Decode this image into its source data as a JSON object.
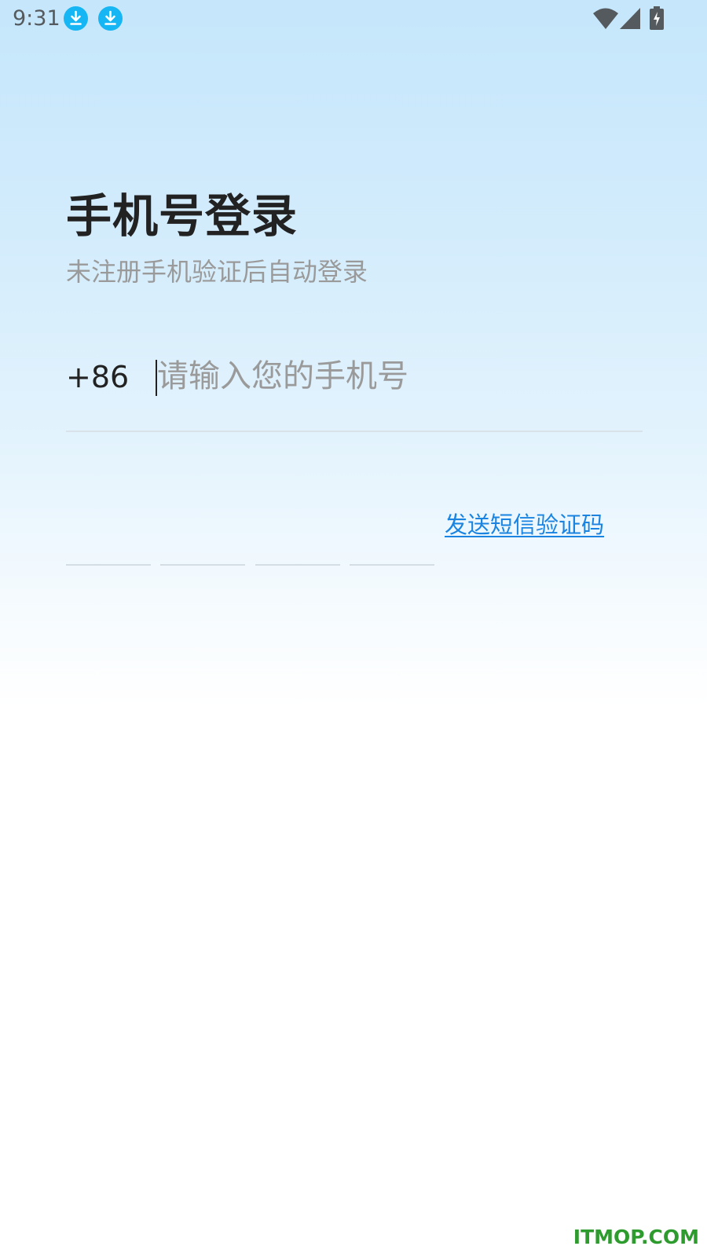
{
  "status_bar": {
    "time": "9:31",
    "icons": [
      "download-icon",
      "download-icon",
      "wifi-icon",
      "signal-icon",
      "battery-charging-icon"
    ]
  },
  "login": {
    "title": "手机号登录",
    "subtitle": "未注册手机验证后自动登录",
    "country_code": "+86",
    "phone_placeholder": "请输入您的手机号",
    "phone_value": "",
    "send_code_label": "发送短信验证码",
    "code_digits": 4
  },
  "watermark": "ITMOP.COM",
  "colors": {
    "accent": "#1a84e0",
    "download_icon": "#16b5f3",
    "watermark": "#2e9b2e"
  }
}
